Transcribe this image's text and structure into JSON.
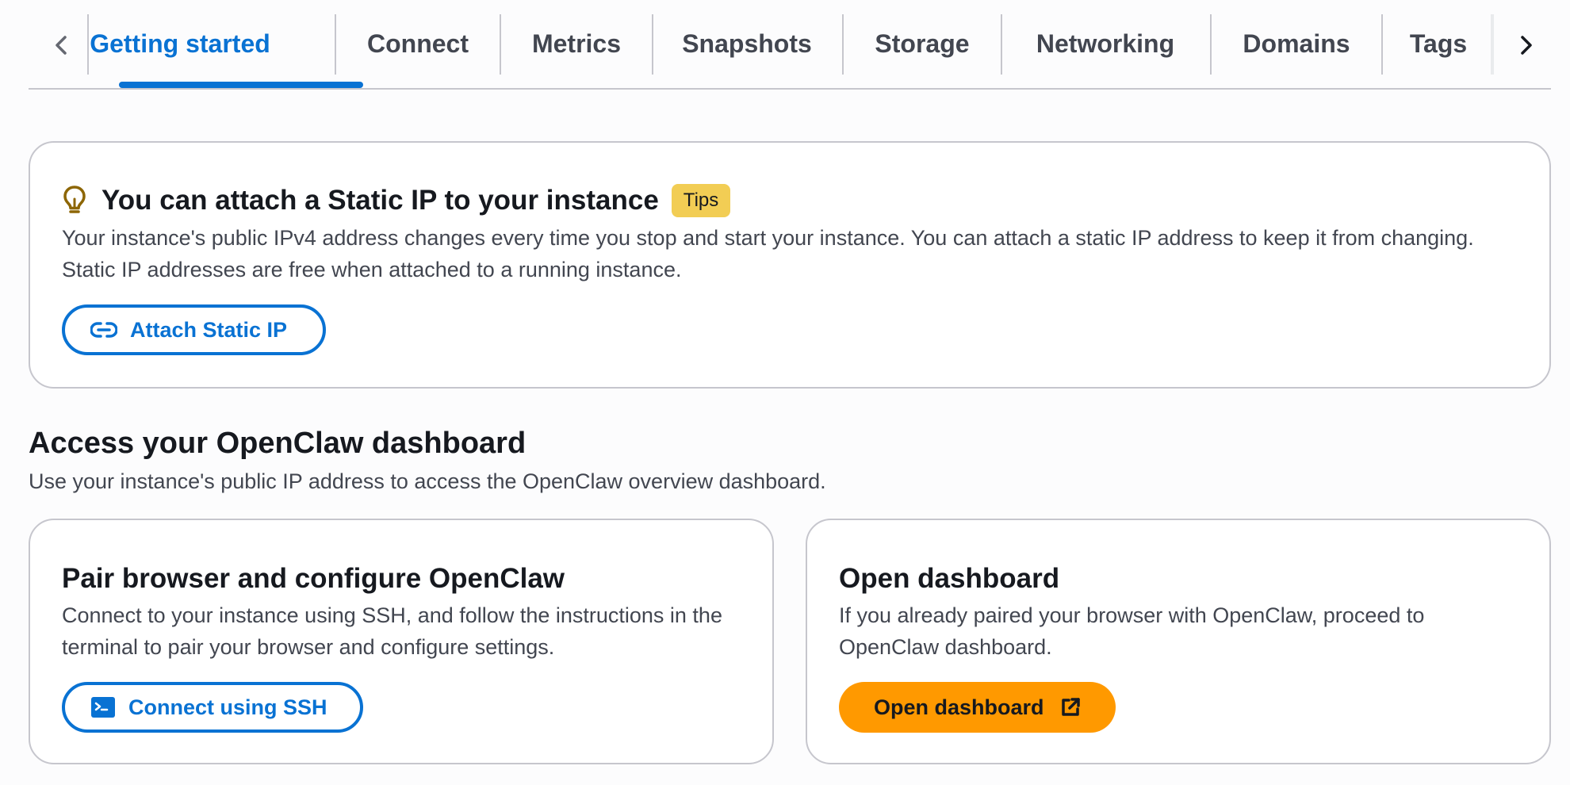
{
  "tabs": {
    "items": [
      {
        "label": "Getting started",
        "active": true
      },
      {
        "label": "Connect",
        "active": false
      },
      {
        "label": "Metrics",
        "active": false
      },
      {
        "label": "Snapshots",
        "active": false
      },
      {
        "label": "Storage",
        "active": false
      },
      {
        "label": "Networking",
        "active": false
      },
      {
        "label": "Domains",
        "active": false
      },
      {
        "label": "Tags",
        "active": false
      }
    ],
    "prev_icon": "chevron-left-icon",
    "next_icon": "chevron-right-icon"
  },
  "alert": {
    "icon": "lightbulb-icon",
    "title": "You can attach a Static IP to your instance",
    "badge": "Tips",
    "body": "Your instance's public IPv4 address changes every time you stop and start your instance. You can attach a static IP address to keep it from changing. Static IP addresses are free when attached to a running instance.",
    "button_label": "Attach Static IP",
    "button_icon": "link-icon"
  },
  "section": {
    "title": "Access your OpenClaw dashboard",
    "description": "Use your instance's public IP address to access the OpenClaw overview dashboard."
  },
  "pair_card": {
    "title": "Pair browser and configure OpenClaw",
    "body": "Connect to your instance using SSH, and follow the instructions in the terminal to pair your browser and configure settings.",
    "button_label": "Connect using SSH",
    "button_icon": "terminal-icon"
  },
  "dashboard_card": {
    "title": "Open dashboard",
    "body": "If you already paired your browser with OpenClaw, proceed to OpenClaw dashboard.",
    "button_label": "Open dashboard",
    "button_icon": "external-link-icon"
  },
  "colors": {
    "accent": "#0972d3",
    "primary_button": "#ff9900",
    "tips_badge": "#f2cd54",
    "border": "#c6c6cd",
    "bulb": "#8d6605"
  }
}
